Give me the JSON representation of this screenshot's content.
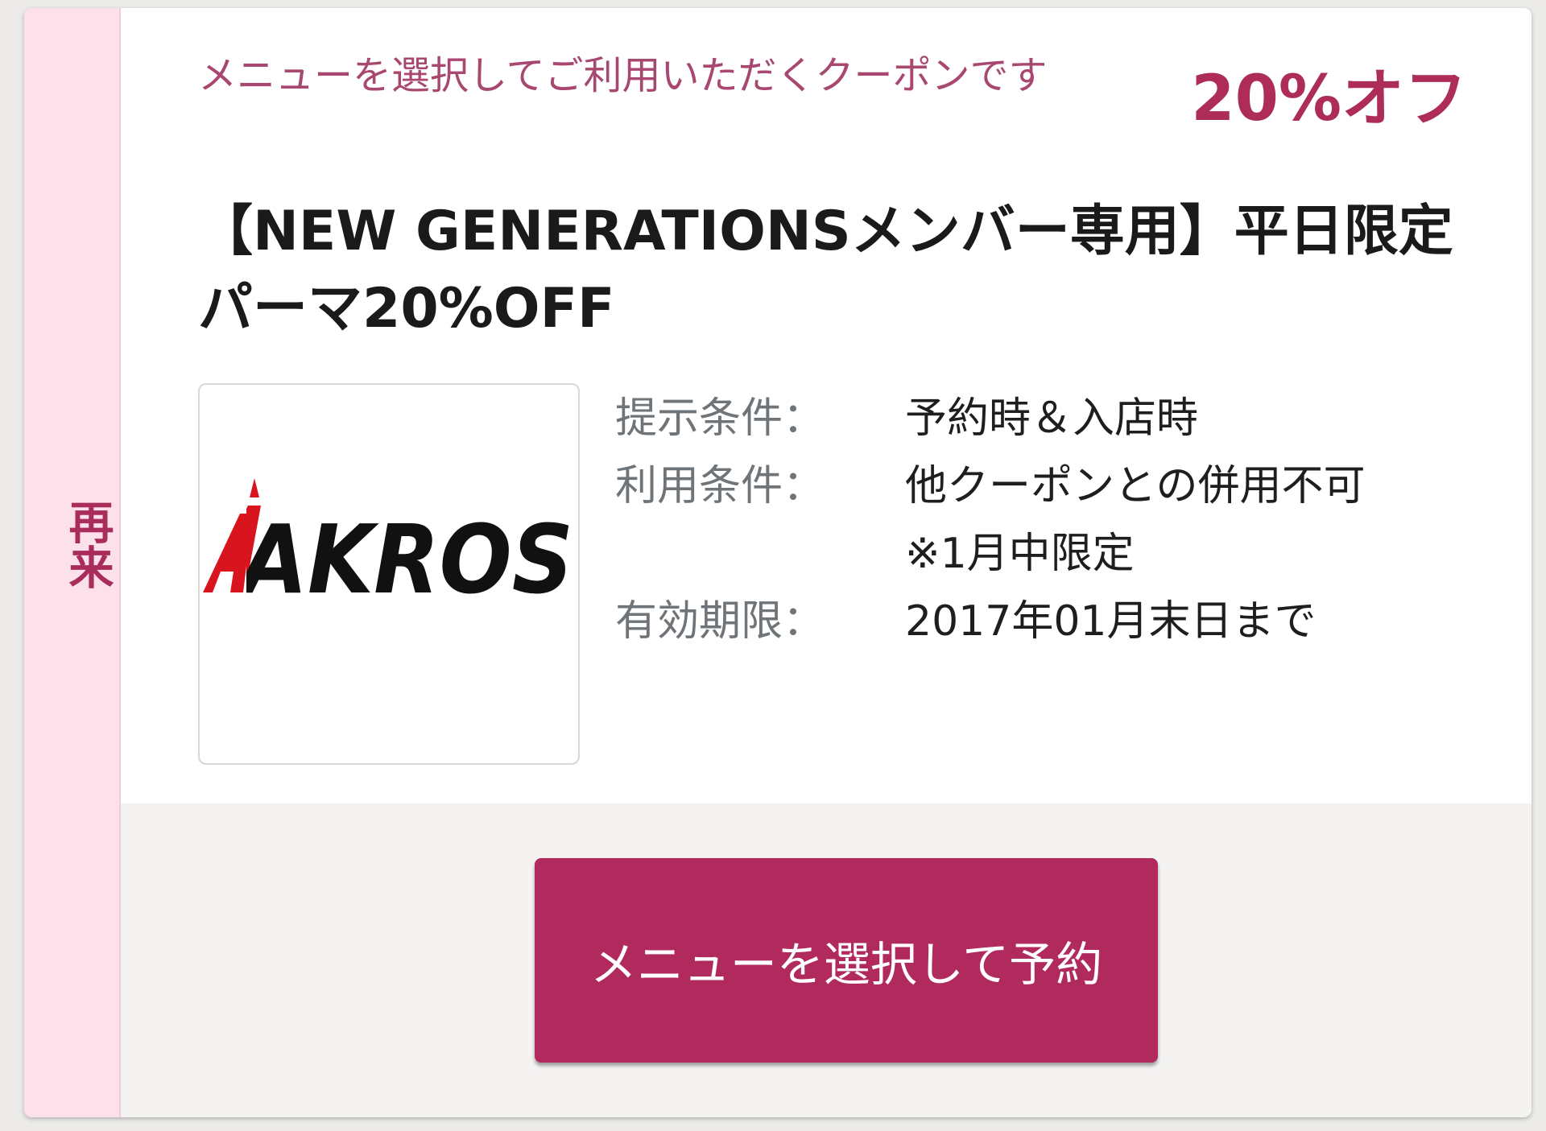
{
  "side_label": [
    "再",
    "来"
  ],
  "coupon": {
    "description": "メニューを選択してご利用いただくクーポンです",
    "discount": "20%オフ",
    "title": "【NEW GENERATIONSメンバー専用】平日限定パーマ20%OFF",
    "logo_text": "AKROS"
  },
  "conditions": [
    {
      "label": "提示条件：",
      "value": "予約時＆入店時"
    },
    {
      "label": "利用条件：",
      "value": "他クーポンとの併用不可　※1月中限定"
    },
    {
      "label": "有効期限：",
      "value": "2017年01月末日まで"
    }
  ],
  "button": {
    "label": "メニューを選択して予約"
  },
  "colors": {
    "accent": "#ae2c5a",
    "side_bg": "#fde1ea",
    "logo_red": "#d8141e"
  }
}
